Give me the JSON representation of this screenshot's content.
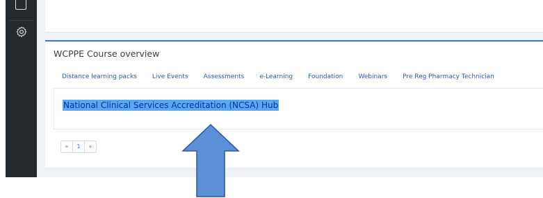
{
  "course_overview": {
    "title": "WCPPE Course overview",
    "tabs": [
      {
        "label": "Distance learning packs"
      },
      {
        "label": "Live Events"
      },
      {
        "label": "Assessments"
      },
      {
        "label": "e-Learning"
      },
      {
        "label": "Foundation"
      },
      {
        "label": "Webinars"
      },
      {
        "label": "Pre Reg Pharmacy Technician"
      }
    ],
    "course_link": "National Clinical Services Accreditation (NCSA) Hub"
  },
  "pagination": {
    "first": "«",
    "page": "1",
    "last": "»"
  },
  "icons": {
    "sidebar_top": "window-icon",
    "sidebar_settings": "gear-icon",
    "annotation": "up-arrow-icon"
  },
  "colors": {
    "accent": "#3d74c5",
    "link": "#2b5bb3",
    "selection_highlight": "#58a8f0",
    "sidebar": "#252a2e",
    "arrow_fill": "#5b8fd6"
  }
}
